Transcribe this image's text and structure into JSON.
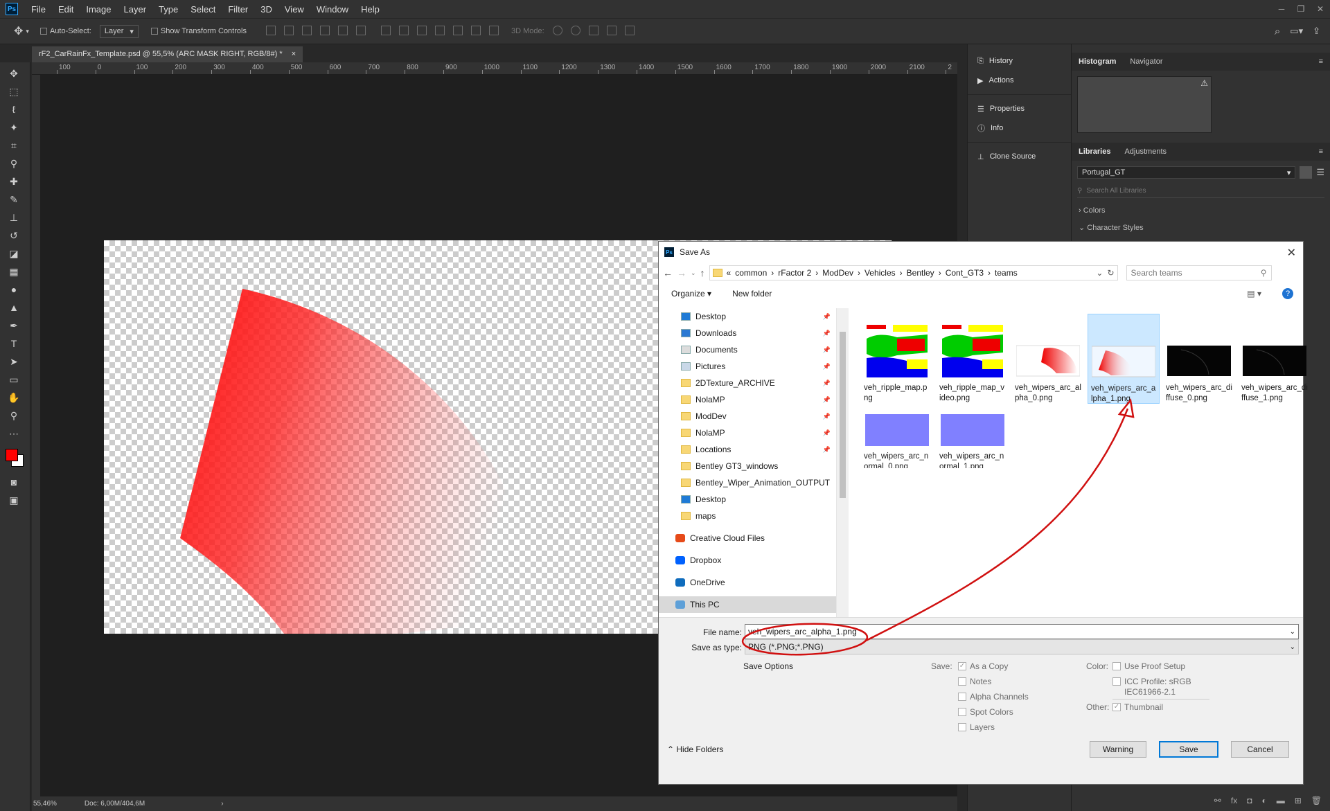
{
  "app": {
    "logo": "Ps"
  },
  "menu": [
    "File",
    "Edit",
    "Image",
    "Layer",
    "Type",
    "Select",
    "Filter",
    "3D",
    "View",
    "Window",
    "Help"
  ],
  "options_bar": {
    "auto_select_label": "Auto-Select:",
    "layer_select": "Layer",
    "show_transform_label": "Show Transform Controls",
    "mode3d_label": "3D Mode:"
  },
  "document": {
    "tab_title": "rF2_CarRainFx_Template.psd @ 55,5% (ARC MASK RIGHT, RGB/8#) *"
  },
  "ruler_labels": [
    "100",
    "0",
    "100",
    "200",
    "300",
    "400",
    "500",
    "600",
    "700",
    "800",
    "900",
    "1000",
    "1100",
    "1200",
    "1300",
    "1400",
    "1500",
    "1600",
    "1700",
    "1800",
    "1900",
    "2000",
    "2100",
    "2"
  ],
  "status": {
    "zoom": "55,46%",
    "doc_info": "Doc: 6,00M/404,6M"
  },
  "colors": {
    "foreground": "#ff0000",
    "background": "#ffffff",
    "accent": "#31a8ff",
    "annotation": "#d01010"
  },
  "panels_mid": [
    "History",
    "Actions",
    "Properties",
    "Info",
    "Clone Source"
  ],
  "panels_right": {
    "top_tabs": [
      "Histogram",
      "Navigator"
    ],
    "lib_tabs": [
      "Libraries",
      "Adjustments"
    ],
    "library_select": "Portugal_GT",
    "search_placeholder": "Search All Libraries",
    "sections": [
      "Colors",
      "Character Styles"
    ]
  },
  "dialog": {
    "title": "Save As",
    "breadcrumb": [
      "«",
      "common",
      "rFactor 2",
      "ModDev",
      "Vehicles",
      "Bentley",
      "Cont_GT3",
      "teams"
    ],
    "search_placeholder": "Search teams",
    "organize": "Organize",
    "new_folder": "New folder",
    "nav_items": [
      {
        "label": "Desktop",
        "icon": "desktop-icon",
        "pinned": true
      },
      {
        "label": "Downloads",
        "icon": "download-icon",
        "pinned": true
      },
      {
        "label": "Documents",
        "icon": "documents-icon",
        "pinned": true
      },
      {
        "label": "Pictures",
        "icon": "pictures-icon",
        "pinned": true
      },
      {
        "label": "2DTexture_ARCHIVE",
        "icon": "folder-icon",
        "pinned": true
      },
      {
        "label": "NolaMP",
        "icon": "folder-icon",
        "pinned": true
      },
      {
        "label": "ModDev",
        "icon": "folder-icon",
        "pinned": true
      },
      {
        "label": "NolaMP",
        "icon": "folder-icon",
        "pinned": true
      },
      {
        "label": "Locations",
        "icon": "folder-icon",
        "pinned": true
      },
      {
        "label": "Bentley GT3_windows",
        "icon": "folder-icon",
        "pinned": false
      },
      {
        "label": "Bentley_Wiper_Animation_OUTPUT",
        "icon": "folder-icon",
        "pinned": false
      },
      {
        "label": "Desktop",
        "icon": "desktop-icon",
        "pinned": false
      },
      {
        "label": "maps",
        "icon": "folder-icon",
        "pinned": false
      }
    ],
    "nav_roots": [
      "Creative Cloud Files",
      "Dropbox",
      "OneDrive",
      "This PC"
    ],
    "files": [
      {
        "name": "veh_ripple_map.png",
        "thumb": "ripple"
      },
      {
        "name": "veh_ripple_map_video.png",
        "thumb": "ripple"
      },
      {
        "name": "veh_wipers_arc_alpha_0.png",
        "thumb": "arc-light"
      },
      {
        "name": "veh_wipers_arc_alpha_1.png",
        "thumb": "arc-left"
      },
      {
        "name": "veh_wipers_arc_diffuse_0.png",
        "thumb": "dark"
      },
      {
        "name": "veh_wipers_arc_diffuse_1.png",
        "thumb": "dark"
      },
      {
        "name": "veh_wipers_arc_normal_0.png",
        "thumb": "normal"
      },
      {
        "name": "veh_wipers_arc_normal_1.png",
        "thumb": "normal"
      }
    ],
    "file_name_label": "File name:",
    "file_name_value": "veh_wipers_arc_alpha_1.png",
    "save_type_label": "Save as type:",
    "save_type_value": "PNG (*.PNG;*.PNG)",
    "save_options_label": "Save Options",
    "save_label": "Save:",
    "save_opts": [
      {
        "label": "As a Copy",
        "checked": true
      },
      {
        "label": "Notes",
        "checked": false
      },
      {
        "label": "Alpha Channels",
        "checked": false
      },
      {
        "label": "Spot Colors",
        "checked": false
      },
      {
        "label": "Layers",
        "checked": false
      }
    ],
    "color_label": "Color:",
    "use_proof": "Use Proof Setup",
    "icc_label": "ICC Profile:  sRGB",
    "icc_line2": "IEC61966-2.1",
    "other_label": "Other:",
    "thumbnail": "Thumbnail",
    "hide_folders": "Hide Folders",
    "btn_warning": "Warning",
    "btn_save": "Save",
    "btn_cancel": "Cancel"
  }
}
